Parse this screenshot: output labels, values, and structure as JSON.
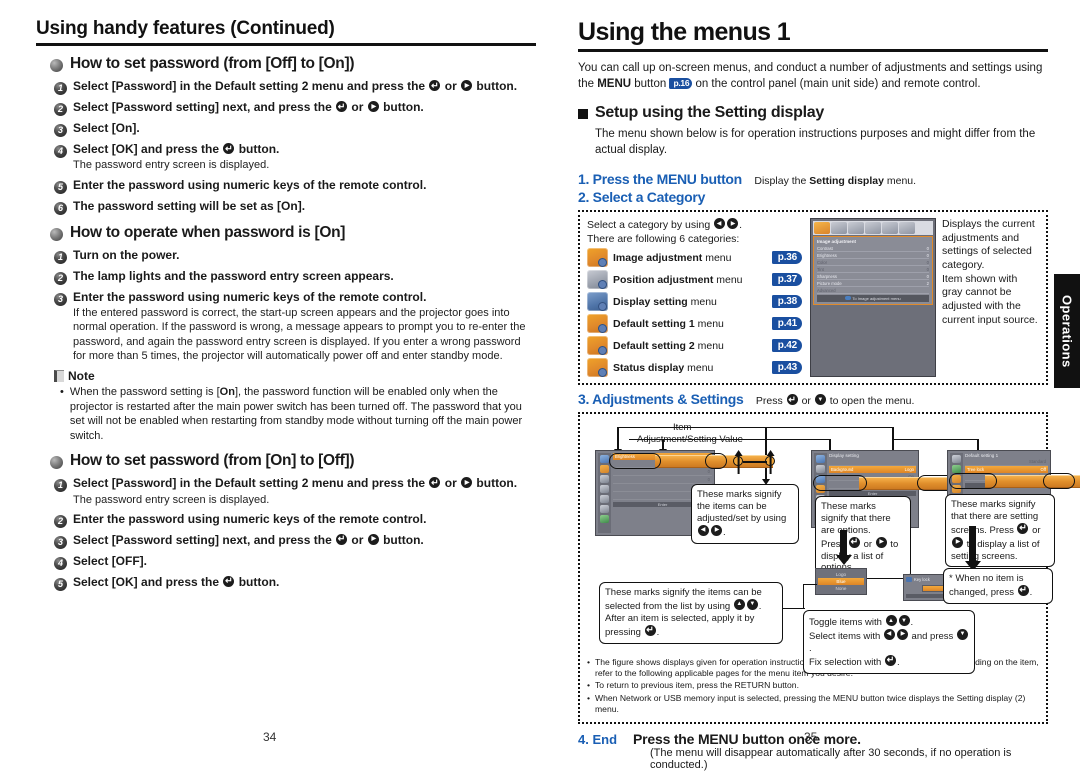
{
  "left_page": {
    "running_head": "Using handy features (Continued)",
    "folio": "34",
    "sections": [
      {
        "heading": "How to set password (from [Off] to [On])",
        "steps": [
          {
            "n": "1",
            "text": "Select [Password] in the Default setting 2 menu and press the ENTER or RIGHT button.",
            "sub": ""
          },
          {
            "n": "2",
            "text": "Select [Password setting] next, and press the ENTER or RIGHT button.",
            "sub": ""
          },
          {
            "n": "3",
            "text": "Select [On].",
            "sub": ""
          },
          {
            "n": "4",
            "text": "Select [OK] and press the ENTER button.",
            "sub": "The password entry screen is displayed."
          },
          {
            "n": "5",
            "text": "Enter the password using numeric keys of the remote control.",
            "sub": ""
          },
          {
            "n": "6",
            "text": "The password setting will be set as [On].",
            "sub": ""
          }
        ]
      },
      {
        "heading": "How to operate when password is [On]",
        "steps": [
          {
            "n": "1",
            "text": "Turn on the power.",
            "sub": ""
          },
          {
            "n": "2",
            "text": "The lamp lights and the password entry screen appears.",
            "sub": ""
          },
          {
            "n": "3",
            "text": "Enter the password using numeric keys of the remote control.",
            "sub": "If the entered password is correct, the start-up screen appears and the projector goes into normal operation. If the password is wrong, a message appears to prompt you to re-enter the password, and again the password entry screen is displayed. If you enter a wrong password for more than 5 times, the projector will automatically power off and enter standby mode."
          }
        ]
      },
      {
        "heading": "How to set password (from [On] to [Off])",
        "steps": [
          {
            "n": "1",
            "text": "Select [Password] in the Default setting 2 menu and press the ENTER or RIGHT button.",
            "sub": "The password entry screen is displayed."
          },
          {
            "n": "2",
            "text": "Enter the password using numeric keys of the remote control.",
            "sub": ""
          },
          {
            "n": "3",
            "text": "Select [Password setting] next, and press the ENTER or RIGHT button.",
            "sub": ""
          },
          {
            "n": "4",
            "text": "Select [OFF].",
            "sub": ""
          },
          {
            "n": "5",
            "text": "Select [OK] and press the ENTER button.",
            "sub": ""
          }
        ]
      }
    ],
    "note": {
      "title": "Note",
      "bullet": "•",
      "items": [
        "When the password setting is [On], the password function will be enabled only when the projector is restarted after the main power switch has been turned off. The password that you set will not be enabled when restarting from standby mode without turning off the main power switch."
      ]
    }
  },
  "right_page": {
    "title": "Using the menus 1",
    "folio": "35",
    "intro_a": "You can call up on-screen menus, and conduct a number of adjustments and settings using",
    "intro_b1": "the ",
    "intro_menu": "MENU",
    "intro_b2": " button ",
    "intro_pref": "p.16",
    "intro_b3": " on the control panel (main unit side) and remote control.",
    "setup_heading": "Setup using the Setting display",
    "setup_text": "The menu shown below is for operation instructions purposes and might differ from the actual display.",
    "step1_label": "1. Press the MENU button",
    "step1_note_a": "Display the ",
    "step1_note_b": "Setting display",
    "step1_note_c": " menu.",
    "step2_label": "2. Select a Category",
    "category_panel": {
      "line1_a": "Select a category by using ",
      "line1_b": ".",
      "line2": "There are following 6 categories:",
      "categories": [
        {
          "name": "Image adjustment",
          "suffix": " menu",
          "page": "p.36",
          "icon": "image-adjustment-icon"
        },
        {
          "name": "Position adjustment",
          "suffix": " menu",
          "page": "p.37",
          "icon": "position-adjustment-icon"
        },
        {
          "name": "Display setting",
          "suffix": " menu",
          "page": "p.38",
          "icon": "display-setting-icon"
        },
        {
          "name": "Default setting 1",
          "suffix": " menu",
          "page": "p.41",
          "icon": "default-setting-1-icon"
        },
        {
          "name": "Default setting 2",
          "suffix": " menu",
          "page": "p.42",
          "icon": "default-setting-2-icon"
        },
        {
          "name": "Status display",
          "suffix": " menu",
          "page": "p.43",
          "icon": "status-display-icon"
        }
      ],
      "description": "Displays the current adjustments and settings of selected category.\nItem shown with gray cannot be adjusted with the current input source.",
      "osd": {
        "title": "Image adjustment",
        "items": [
          {
            "label": "Contrast",
            "value": "0",
            "gray": false
          },
          {
            "label": "Brightness",
            "value": "0",
            "gray": false
          },
          {
            "label": "Color",
            "value": "0",
            "gray": true
          },
          {
            "label": "Tint",
            "value": "0",
            "gray": true
          },
          {
            "label": "Sharpness",
            "value": "0",
            "gray": false
          },
          {
            "label": "Picture mode",
            "value": "2",
            "gray": false
          },
          {
            "label": "Advanced",
            "value": "",
            "gray": true
          }
        ],
        "footer": "To Image adjustment menu"
      }
    },
    "step3_label": "3. Adjustments & Settings",
    "step3_note_a": "Press ",
    "step3_note_mid": " or ",
    "step3_note_b": " to open the menu.",
    "figure": {
      "label_item": "Item",
      "label_value": "Adjustment/Setting Value",
      "callout_1": "These marks signify the items can be adjusted/set by using",
      "callout_1_end": ".",
      "callout_2_a": "These marks signify that there are options.",
      "callout_2_b": "Press ",
      "callout_2_c": " or ",
      "callout_2_d": " to display a list of options.",
      "callout_3_a": "These marks signify that there are setting screens. Press ",
      "callout_3_b": " or ",
      "callout_3_c": " to display a list of setting screens.",
      "callout_4_a": "These marks signify the items can be selected from the list by using",
      "callout_4_b": ".",
      "callout_4_c": "After an item is selected, apply it by pressing ",
      "callout_4_d": ".",
      "callout_5_a": "* When no item is changed, press ",
      "callout_5_b": ".",
      "callout_6_a": "Toggle items with ",
      "callout_6_b": ".",
      "callout_6_c": "Select items with ",
      "callout_6_d": " and press ",
      "callout_6_e": ".",
      "callout_6_f": "Fix selection with ",
      "callout_6_g": ".",
      "panel_a": {
        "title": "Image adjustment",
        "row_label": "Brightness",
        "value": "0"
      },
      "panel_b": {
        "title": "Display setting",
        "row_label": "Background",
        "value": "Logo"
      },
      "panel_c": {
        "title": "Default setting 1",
        "row_label": "Tree lock",
        "value": "Off"
      },
      "dropdown": {
        "items": [
          "Logo",
          "Blue",
          "None"
        ],
        "selected": "Blue"
      },
      "dialog": {
        "title": "Key lock",
        "ok": "OK",
        "cancel": "Cancel",
        "footer": "Enter"
      }
    },
    "fine_print": [
      "The figure shows displays given for operation instructions purposes.  As the display may differ depending on the item, refer to the following applicable pages for the menu item you desire.",
      "To return to previous item, press the RETURN button.",
      "When Network or USB memory input is selected, pressing the MENU button twice displays the Setting display (2) menu."
    ],
    "step4_label": "4. End",
    "step4_heading": "Press the MENU button once more.",
    "step4_note": "(The menu will disappear automatically after 30 seconds, if no operation is conducted.)"
  },
  "side_tab": {
    "label": "Operations"
  },
  "colors": {
    "accent_blue": "#1a5fb4",
    "badge_blue": "#1a4fa0",
    "osd_orange": "#e08f2c",
    "tab_black": "#111111"
  }
}
